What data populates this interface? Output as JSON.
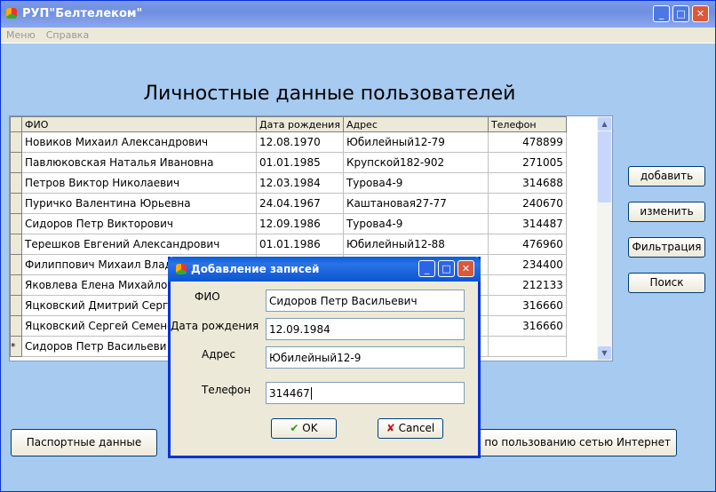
{
  "window": {
    "title": "РУП\"Белтелеком\""
  },
  "menu": [
    "Меню",
    "Справка"
  ],
  "heading": "Личностные данные пользователей",
  "table": {
    "columns": [
      "ФИО",
      "Дата рождения",
      "Адрес",
      "Телефон"
    ],
    "rows": [
      [
        "Новиков Михаил Александрович",
        "12.08.1970",
        "Юбилейный12-79",
        "478899"
      ],
      [
        "Павлюковская Наталья Ивановна",
        "01.01.1985",
        "Крупской182-902",
        "271005"
      ],
      [
        "Петров Виктор Николаевич",
        "12.03.1984",
        "Турова4-9",
        "314688"
      ],
      [
        "Пуричко Валентина Юрьевна",
        "24.04.1967",
        "Каштановая27-77",
        "240670"
      ],
      [
        "Сидоров Петр Викторович",
        "12.09.1986",
        "Турова4-9",
        "314487"
      ],
      [
        "Терешков Евгений Александрович",
        "01.01.1986",
        "Юбилейный12-88",
        "476960"
      ],
      [
        "Филиппович Михаил Влад",
        "",
        "",
        "234400"
      ],
      [
        "Яковлева Елена Михайло",
        "",
        "",
        "212133"
      ],
      [
        "Яцковский Дмитрий Серге",
        "",
        "",
        "316660"
      ],
      [
        "Яцковский Сергей Семено",
        "",
        "",
        "316660"
      ]
    ],
    "new_row": {
      "marker": "*",
      "fio": "Сидоров Петр Васильеви"
    }
  },
  "buttons": {
    "add": "добавить",
    "edit": "изменить",
    "filter": "Фильтрация",
    "search": "Поиск",
    "passport": "Паспортные данные",
    "internet": "е по пользованию сетью Интернет"
  },
  "dialog": {
    "title": "Добавление записей",
    "fields": [
      {
        "label": "ФИО",
        "value": "Сидоров Петр Васильевич"
      },
      {
        "label": "Дата рождения",
        "value": "12.09.1984"
      },
      {
        "label": "Адрес",
        "value": "Юбилейный12-9"
      },
      {
        "label": "Телефон",
        "value": "314467"
      }
    ],
    "ok": "OK",
    "cancel": "Cancel"
  }
}
